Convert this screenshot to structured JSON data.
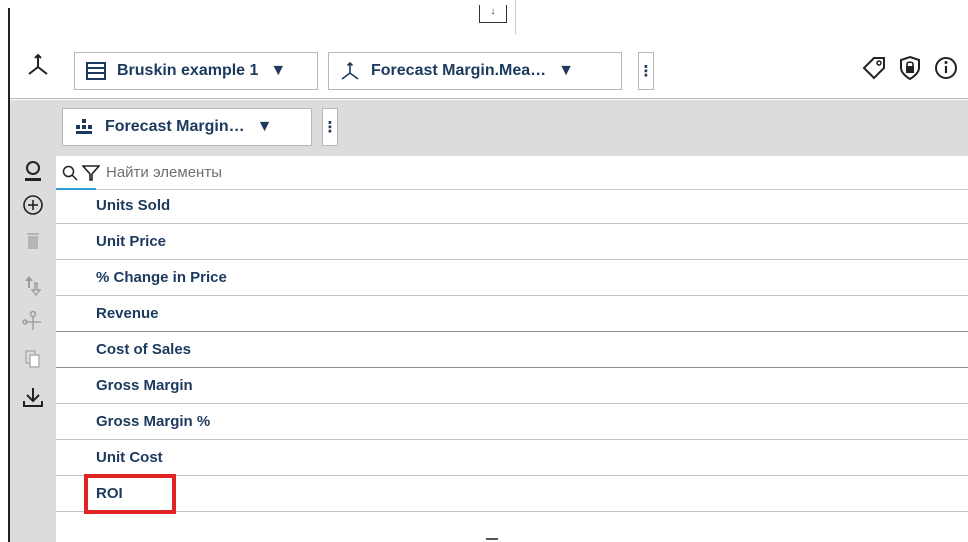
{
  "toolbar": {
    "dataset_selector": {
      "icon": "table-icon",
      "label": "Bruskin example 1"
    },
    "measure_selector": {
      "icon": "axis-icon",
      "label": "Forecast Margin.Mea…"
    },
    "right_icons": [
      "tag-icon",
      "shield-lock-icon",
      "info-icon"
    ]
  },
  "dimension_selector": {
    "icon": "hierarchy-icon",
    "label": "Forecast Margin…"
  },
  "search": {
    "placeholder": "Найти элементы"
  },
  "rail_icons": [
    "user-icon",
    "add-icon",
    "trash-icon",
    "move-icon",
    "split-icon",
    "copy-icon",
    "download-icon"
  ],
  "items": [
    {
      "label": "Units Sold"
    },
    {
      "label": "Unit Price"
    },
    {
      "label": "% Change in Price"
    },
    {
      "label": "Revenue"
    },
    {
      "label": "Cost of Sales"
    },
    {
      "label": "Gross Margin"
    },
    {
      "label": "Gross Margin %"
    },
    {
      "label": "Unit Cost"
    },
    {
      "label": "ROI"
    }
  ],
  "colors": {
    "highlight": "#e02424",
    "text": "#1c3a5e",
    "accent": "#2c9fd8"
  }
}
